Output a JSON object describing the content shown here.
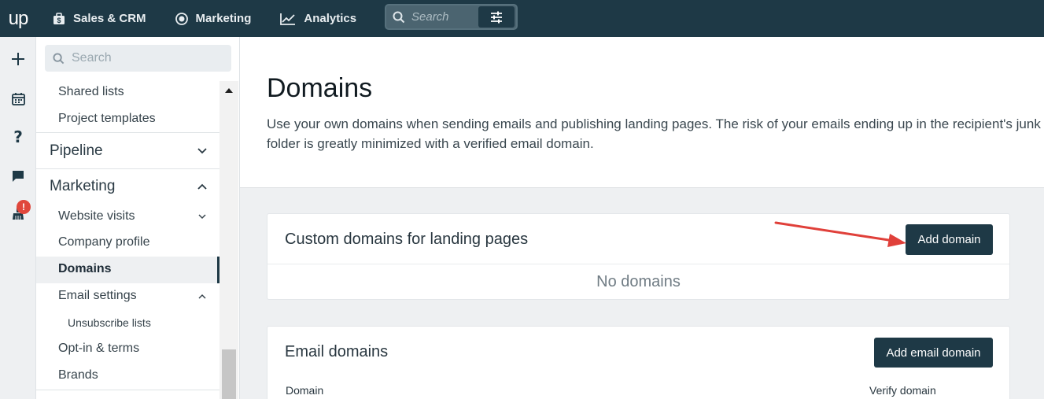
{
  "topbar": {
    "logo": "up",
    "nav": [
      {
        "label": "Sales & CRM",
        "icon": "briefcase-dollar-icon"
      },
      {
        "label": "Marketing",
        "icon": "target-icon"
      },
      {
        "label": "Analytics",
        "icon": "chart-line-icon"
      }
    ],
    "search_placeholder": "Search"
  },
  "rail": {
    "icons": [
      "plus-icon",
      "calendar-icon",
      "help-icon",
      "chat-icon",
      "broom-icon"
    ],
    "alert_badge": "!"
  },
  "sidebar": {
    "search_placeholder": "Search",
    "top_items": [
      "Shared lists",
      "Project templates"
    ],
    "pipeline": "Pipeline",
    "marketing": "Marketing",
    "marketing_items": {
      "website_visits": "Website visits",
      "company_profile": "Company profile",
      "domains": "Domains",
      "email_settings": "Email settings",
      "unsubscribe_lists": "Unsubscribe lists",
      "opt_in": "Opt-in & terms",
      "brands": "Brands"
    }
  },
  "main": {
    "title": "Domains",
    "description": "Use your own domains when sending emails and publishing landing pages. The risk of your emails ending up in the recipient's junk folder is greatly minimized with a verified email domain.",
    "landing_card": {
      "title": "Custom domains for landing pages",
      "button": "Add domain",
      "empty": "No domains"
    },
    "email_card": {
      "title": "Email domains",
      "button": "Add email domain",
      "columns": [
        "Domain",
        "Verify domain"
      ]
    }
  },
  "colors": {
    "primary": "#1e3946",
    "annotation_arrow": "#e0403a",
    "badge": "#e0473c"
  }
}
